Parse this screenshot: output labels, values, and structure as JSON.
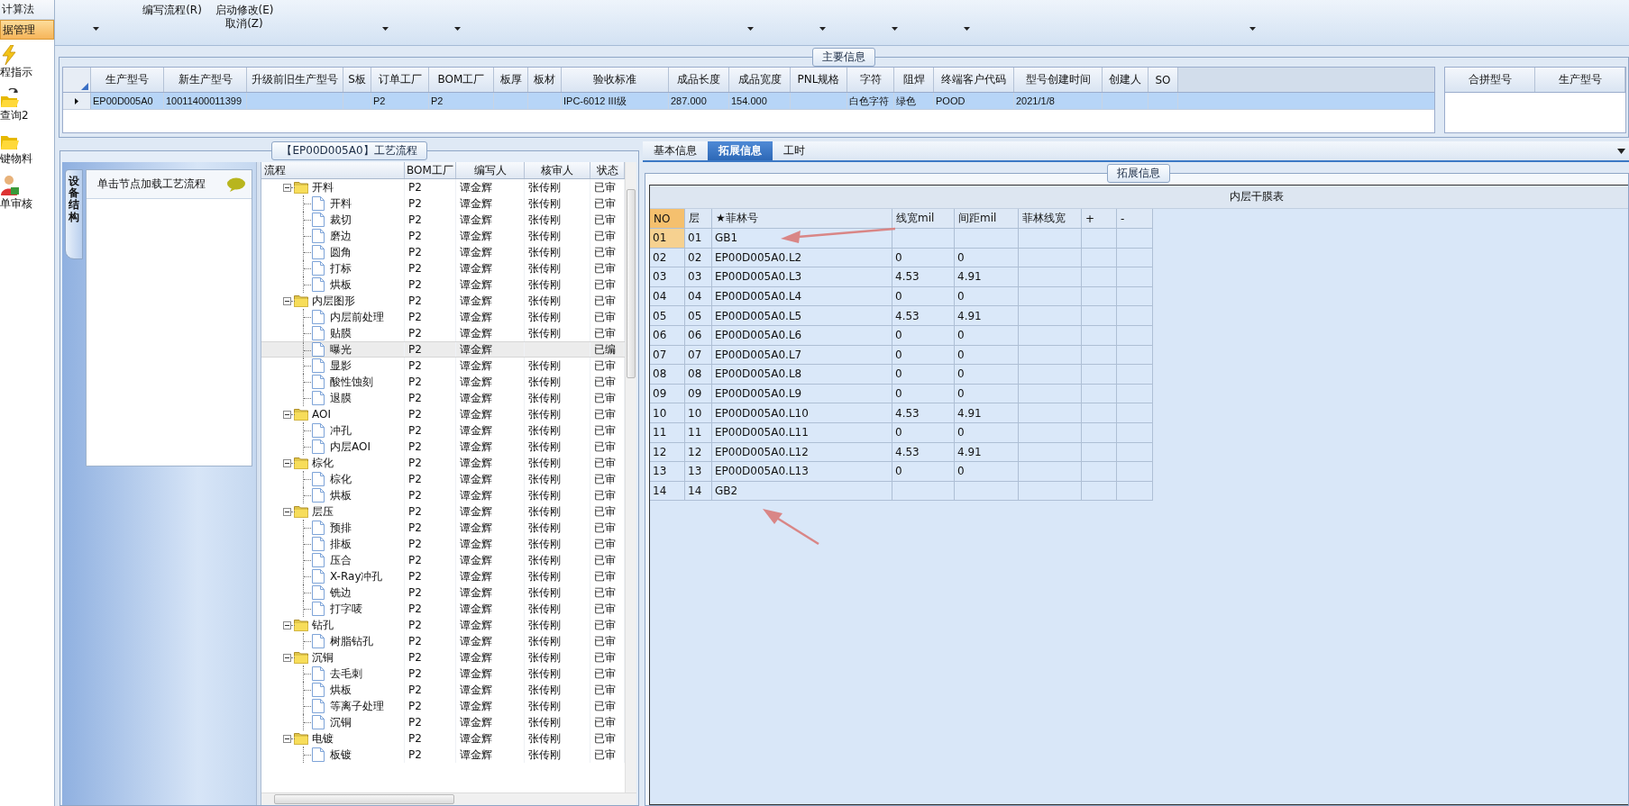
{
  "sidebar": {
    "items": [
      {
        "label": "计算法",
        "selected": false,
        "kind": "text"
      },
      {
        "label": "据管理",
        "selected": true,
        "kind": "text"
      },
      {
        "label": "程指示",
        "selected": false,
        "kind": "lightning"
      },
      {
        "label": "查询2",
        "selected": false,
        "kind": "folder-arrow"
      },
      {
        "label": "键物料",
        "selected": false,
        "kind": "folder"
      },
      {
        "label": "单审核",
        "selected": false,
        "kind": "person"
      }
    ]
  },
  "toolbar": {
    "items": [
      {
        "kind": "caret"
      },
      {
        "kind": "button",
        "lines": [
          "编写流程(R)"
        ]
      },
      {
        "kind": "button",
        "lines": [
          "启动修改(E)",
          "取消(Z)"
        ]
      },
      {
        "kind": "caret"
      },
      {
        "kind": "caret"
      },
      {
        "kind": "caret"
      },
      {
        "kind": "caret"
      },
      {
        "kind": "caret"
      },
      {
        "kind": "caret"
      },
      {
        "kind": "caret"
      }
    ]
  },
  "main_info": {
    "title": "主要信息",
    "columns": [
      "生产型号",
      "新生产型号",
      "升级前旧生产型号",
      "S板",
      "订单工厂",
      "BOM工厂",
      "板厚",
      "板材",
      "验收标准",
      "成品长度",
      "成品宽度",
      "PNL规格",
      "字符",
      "阻焊",
      "终端客户代码",
      "型号创建时间",
      "创建人",
      "SO"
    ],
    "rows": [
      {
        "selected": true,
        "cells": [
          "EP00D005A0",
          "10011400011399",
          null,
          null,
          "P2",
          "P2",
          null,
          null,
          "IPC-6012 III级",
          "287.000",
          "154.000",
          null,
          "白色字符",
          "绿色",
          "POOD",
          "2021/1/8",
          null,
          null
        ]
      }
    ],
    "merge_table": {
      "columns": [
        "合拼型号",
        "生产型号"
      ]
    }
  },
  "process_panel": {
    "title": "【EP00D005A0】工艺流程",
    "side_tab": "设备结构",
    "hint": "单击节点加载工艺流程",
    "tree": {
      "columns": [
        "流程",
        "BOM工厂",
        "编写人",
        "核审人",
        "状态"
      ],
      "rows": [
        {
          "label": "开料",
          "bom": "P2",
          "writer": "谭金辉",
          "reviewer": "张传刚",
          "status": "已审",
          "expanded": true,
          "selected": false,
          "children": [
            {
              "label": "开料",
              "bom": "P2",
              "writer": "谭金辉",
              "reviewer": "张传刚",
              "status": "已审",
              "selected": false
            },
            {
              "label": "裁切",
              "bom": "P2",
              "writer": "谭金辉",
              "reviewer": "张传刚",
              "status": "已审",
              "selected": false
            },
            {
              "label": "磨边",
              "bom": "P2",
              "writer": "谭金辉",
              "reviewer": "张传刚",
              "status": "已审",
              "selected": false
            },
            {
              "label": "圆角",
              "bom": "P2",
              "writer": "谭金辉",
              "reviewer": "张传刚",
              "status": "已审",
              "selected": false
            },
            {
              "label": "打标",
              "bom": "P2",
              "writer": "谭金辉",
              "reviewer": "张传刚",
              "status": "已审",
              "selected": false
            },
            {
              "label": "烘板",
              "bom": "P2",
              "writer": "谭金辉",
              "reviewer": "张传刚",
              "status": "已审",
              "selected": false
            }
          ]
        },
        {
          "label": "内层图形",
          "bom": "P2",
          "writer": "谭金辉",
          "reviewer": "张传刚",
          "status": "已审",
          "expanded": true,
          "selected": false,
          "children": [
            {
              "label": "内层前处理",
              "bom": "P2",
              "writer": "谭金辉",
              "reviewer": "张传刚",
              "status": "已审",
              "selected": false
            },
            {
              "label": "贴膜",
              "bom": "P2",
              "writer": "谭金辉",
              "reviewer": "张传刚",
              "status": "已审",
              "selected": false
            },
            {
              "label": "曝光",
              "bom": "P2",
              "writer": "谭金辉",
              "status": "已编",
              "selected": true
            },
            {
              "label": "显影",
              "bom": "P2",
              "writer": "谭金辉",
              "reviewer": "张传刚",
              "status": "已审",
              "selected": false
            },
            {
              "label": "酸性蚀刻",
              "bom": "P2",
              "writer": "谭金辉",
              "reviewer": "张传刚",
              "status": "已审",
              "selected": false
            },
            {
              "label": "退膜",
              "bom": "P2",
              "writer": "谭金辉",
              "reviewer": "张传刚",
              "status": "已审",
              "selected": false
            }
          ]
        },
        {
          "label": "AOI",
          "bom": "P2",
          "writer": "谭金辉",
          "reviewer": "张传刚",
          "status": "已审",
          "expanded": true,
          "selected": false,
          "children": [
            {
              "label": "冲孔",
              "bom": "P2",
              "writer": "谭金辉",
              "reviewer": "张传刚",
              "status": "已审",
              "selected": false
            },
            {
              "label": "内层AOI",
              "bom": "P2",
              "writer": "谭金辉",
              "reviewer": "张传刚",
              "status": "已审",
              "selected": false
            }
          ]
        },
        {
          "label": "棕化",
          "bom": "P2",
          "writer": "谭金辉",
          "reviewer": "张传刚",
          "status": "已审",
          "expanded": true,
          "selected": false,
          "children": [
            {
              "label": "棕化",
              "bom": "P2",
              "writer": "谭金辉",
              "reviewer": "张传刚",
              "status": "已审",
              "selected": false
            },
            {
              "label": "烘板",
              "bom": "P2",
              "writer": "谭金辉",
              "reviewer": "张传刚",
              "status": "已审",
              "selected": false
            }
          ]
        },
        {
          "label": "层压",
          "bom": "P2",
          "writer": "谭金辉",
          "reviewer": "张传刚",
          "status": "已审",
          "expanded": true,
          "selected": false,
          "children": [
            {
              "label": "预排",
              "bom": "P2",
              "writer": "谭金辉",
              "reviewer": "张传刚",
              "status": "已审",
              "selected": false
            },
            {
              "label": "排板",
              "bom": "P2",
              "writer": "谭金辉",
              "reviewer": "张传刚",
              "status": "已审",
              "selected": false
            },
            {
              "label": "压合",
              "bom": "P2",
              "writer": "谭金辉",
              "reviewer": "张传刚",
              "status": "已审",
              "selected": false
            },
            {
              "label": "X-Ray冲孔",
              "bom": "P2",
              "writer": "谭金辉",
              "reviewer": "张传刚",
              "status": "已审",
              "selected": false
            },
            {
              "label": "铣边",
              "bom": "P2",
              "writer": "谭金辉",
              "reviewer": "张传刚",
              "status": "已审",
              "selected": false
            },
            {
              "label": "打字唛",
              "bom": "P2",
              "writer": "谭金辉",
              "reviewer": "张传刚",
              "status": "已审",
              "selected": false
            }
          ]
        },
        {
          "label": "钻孔",
          "bom": "P2",
          "writer": "谭金辉",
          "reviewer": "张传刚",
          "status": "已审",
          "expanded": true,
          "selected": false,
          "children": [
            {
              "label": "树脂钻孔",
              "bom": "P2",
              "writer": "谭金辉",
              "reviewer": "张传刚",
              "status": "已审",
              "selected": false
            }
          ]
        },
        {
          "label": "沉铜",
          "bom": "P2",
          "writer": "谭金辉",
          "reviewer": "张传刚",
          "status": "已审",
          "expanded": true,
          "selected": false,
          "children": [
            {
              "label": "去毛刺",
              "bom": "P2",
              "writer": "谭金辉",
              "reviewer": "张传刚",
              "status": "已审",
              "selected": false
            },
            {
              "label": "烘板",
              "bom": "P2",
              "writer": "谭金辉",
              "reviewer": "张传刚",
              "status": "已审",
              "selected": false
            },
            {
              "label": "等离子处理",
              "bom": "P2",
              "writer": "谭金辉",
              "reviewer": "张传刚",
              "status": "已审",
              "selected": false
            },
            {
              "label": "沉铜",
              "bom": "P2",
              "writer": "谭金辉",
              "reviewer": "张传刚",
              "status": "已审",
              "selected": false
            }
          ]
        },
        {
          "label": "电镀",
          "bom": "P2",
          "writer": "谭金辉",
          "reviewer": "张传刚",
          "status": "已审",
          "expanded": true,
          "selected": false,
          "children": [
            {
              "label": "板镀",
              "bom": "P2",
              "writer": "谭金辉",
              "reviewer": "张传刚",
              "status": "已审",
              "selected": false
            }
          ]
        }
      ]
    }
  },
  "detail_panel": {
    "tabs": [
      {
        "label": "基本信息",
        "selected": false
      },
      {
        "label": "拓展信息",
        "selected": true
      },
      {
        "label": "工时",
        "selected": false
      }
    ],
    "group_title": "拓展信息",
    "table": {
      "title": "内层干膜表",
      "columns": [
        "NO",
        "层",
        "★菲林号",
        "线宽mil",
        "间距mil",
        "菲林线宽",
        "+",
        "-"
      ],
      "rows": [
        {
          "current": true,
          "cells": [
            "01",
            "01",
            "GB1",
            null,
            null,
            null,
            null,
            null
          ]
        },
        {
          "current": false,
          "cells": [
            "02",
            "02",
            "EP00D005A0.L2",
            "0",
            "0",
            null,
            null,
            null
          ]
        },
        {
          "current": false,
          "cells": [
            "03",
            "03",
            "EP00D005A0.L3",
            "4.53",
            "4.91",
            null,
            null,
            null
          ]
        },
        {
          "current": false,
          "cells": [
            "04",
            "04",
            "EP00D005A0.L4",
            "0",
            "0",
            null,
            null,
            null
          ]
        },
        {
          "current": false,
          "cells": [
            "05",
            "05",
            "EP00D005A0.L5",
            "4.53",
            "4.91",
            null,
            null,
            null
          ]
        },
        {
          "current": false,
          "cells": [
            "06",
            "06",
            "EP00D005A0.L6",
            "0",
            "0",
            null,
            null,
            null
          ]
        },
        {
          "current": false,
          "cells": [
            "07",
            "07",
            "EP00D005A0.L7",
            "0",
            "0",
            null,
            null,
            null
          ]
        },
        {
          "current": false,
          "cells": [
            "08",
            "08",
            "EP00D005A0.L8",
            "0",
            "0",
            null,
            null,
            null
          ]
        },
        {
          "current": false,
          "cells": [
            "09",
            "09",
            "EP00D005A0.L9",
            "0",
            "0",
            null,
            null,
            null
          ]
        },
        {
          "current": false,
          "cells": [
            "10",
            "10",
            "EP00D005A0.L10",
            "4.53",
            "4.91",
            null,
            null,
            null
          ]
        },
        {
          "current": false,
          "cells": [
            "11",
            "11",
            "EP00D005A0.L11",
            "0",
            "0",
            null,
            null,
            null
          ]
        },
        {
          "current": false,
          "cells": [
            "12",
            "12",
            "EP00D005A0.L12",
            "4.53",
            "4.91",
            null,
            null,
            null
          ]
        },
        {
          "current": false,
          "cells": [
            "13",
            "13",
            "EP00D005A0.L13",
            "0",
            "0",
            null,
            null,
            null
          ]
        },
        {
          "current": false,
          "cells": [
            "14",
            "14",
            "GB2",
            null,
            null,
            null,
            null,
            null
          ]
        }
      ]
    }
  }
}
